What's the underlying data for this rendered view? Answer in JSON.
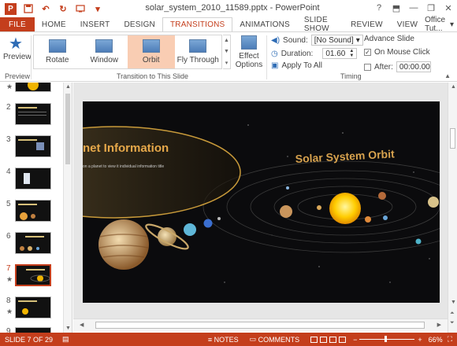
{
  "window": {
    "title": "solar_system_2010_11589.pptx - PowerPoint",
    "help": "?",
    "min": "—",
    "restore": "❐",
    "close": "✕"
  },
  "tabs": [
    {
      "label": "FILE"
    },
    {
      "label": "HOME"
    },
    {
      "label": "INSERT"
    },
    {
      "label": "DESIGN"
    },
    {
      "label": "TRANSITIONS"
    },
    {
      "label": "ANIMATIONS"
    },
    {
      "label": "SLIDE SHOW"
    },
    {
      "label": "REVIEW"
    },
    {
      "label": "VIEW"
    }
  ],
  "user": {
    "name": "Office Tut..."
  },
  "ribbon": {
    "preview_label": "Preview",
    "preview_group": "Preview",
    "transitions_group": "Transition to This Slide",
    "gallery": [
      {
        "label": "Rotate"
      },
      {
        "label": "Window"
      },
      {
        "label": "Orbit"
      },
      {
        "label": "Fly Through"
      }
    ],
    "effect_options": "Effect Options",
    "timing_group": "Timing",
    "sound_label": "Sound:",
    "sound_value": "[No Sound]",
    "duration_label": "Duration:",
    "duration_value": "01.60",
    "apply_all": "Apply To All",
    "advance_label": "Advance Slide",
    "on_click_label": "On Mouse Click",
    "after_label": "After:",
    "after_value": "00:00.00"
  },
  "slides": [
    {
      "num": "2"
    },
    {
      "num": "3"
    },
    {
      "num": "4"
    },
    {
      "num": "5"
    },
    {
      "num": "6"
    },
    {
      "num": "7"
    },
    {
      "num": "8"
    },
    {
      "num": "9"
    }
  ],
  "slide": {
    "left_title": "net Information",
    "left_sub": "on a planet to view it individual information title",
    "right_title": "Solar System Orbit"
  },
  "status": {
    "slide_info": "SLIDE 7 OF 29",
    "notes": "NOTES",
    "comments": "COMMENTS",
    "zoom": "66%"
  }
}
